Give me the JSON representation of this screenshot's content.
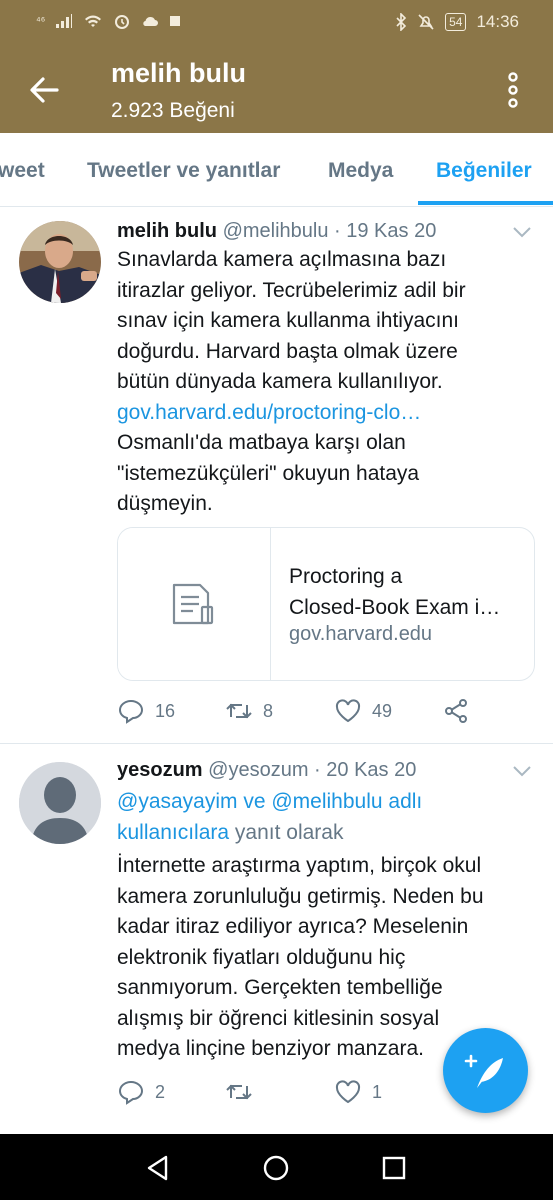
{
  "status_bar": {
    "time": "14:36",
    "battery": "54",
    "signal_label": "⁴⁶"
  },
  "header": {
    "title": "melih bulu",
    "subtitle": "2.923 Beğeni"
  },
  "tabs": [
    {
      "label": "weet"
    },
    {
      "label": "Tweetler ve yanıtlar"
    },
    {
      "label": "Medya"
    },
    {
      "label": "Beğeniler",
      "active": true
    }
  ],
  "tweets": [
    {
      "name": "melih bulu",
      "handle_date": "@melihbulu · 19 Kas 20",
      "text_lines": [
        "Sınavlarda kamera açılmasına bazı",
        "itirazlar geliyor. Tecrübelerimiz adil bir",
        "sınav için kamera kullanma ihtiyacını",
        "doğurdu. Harvard başta olmak üzere",
        "bütün dünyada kamera kullanılıyor."
      ],
      "link": "gov.harvard.edu/proctoring-clo…",
      "text_lines_after": [
        "Osmanlı'da matbaya karşı olan",
        "\"istemezükçüleri\" okuyun hataya",
        "düşmeyin."
      ],
      "card": {
        "title_line1": "Proctoring a",
        "title_line2": "Closed-Book Exam i…",
        "domain": "gov.harvard.edu"
      },
      "replies": "16",
      "retweets": "8",
      "likes": "49"
    },
    {
      "name": "yesozum",
      "handle_date": "@yesozum · 20 Kas 20",
      "reply_to_line1": "@yasayayim ve @melihbulu adlı",
      "reply_to_link2": "kullanıcılara",
      "reply_to_suffix": " yanıt olarak",
      "text_lines": [
        "İnternette araştırma yaptım, birçok okul",
        "kamera zorunluluğu getirmiş. Neden bu",
        "kadar itiraz ediliyor ayrıca? Meselenin",
        "elektronik fiyatları olduğunu hiç",
        "sanmıyorum. Gerçekten tembelliğe",
        "alışmış bir öğrenci kitlesinin sosyal",
        "medya linçine benziyor manzara."
      ],
      "replies": "2",
      "retweets": "",
      "likes": "1"
    }
  ],
  "colors": {
    "header_bg": "#8b7648",
    "accent": "#1da1f2",
    "link": "#1b95e0",
    "muted": "#657786"
  }
}
